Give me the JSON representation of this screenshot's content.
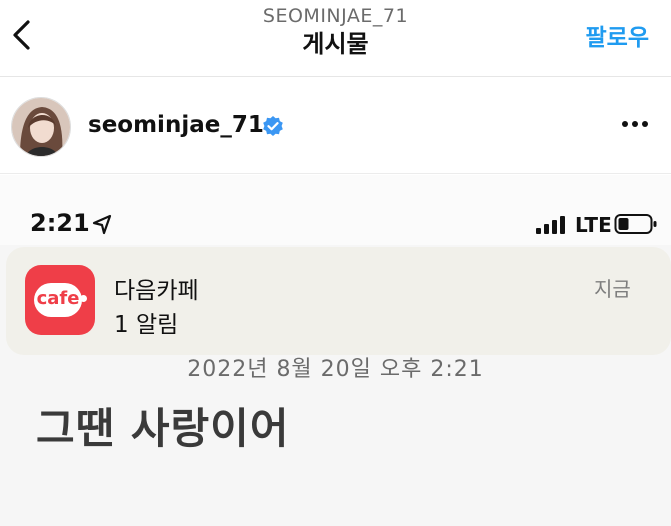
{
  "header": {
    "username": "SEOMINJAE_71",
    "title": "게시물",
    "follow_label": "팔로우"
  },
  "profile": {
    "name": "seominjae_71"
  },
  "post": {
    "status_bar": {
      "time": "2:21",
      "network": "LTE"
    },
    "notification": {
      "app_name": "다음카페",
      "app_icon_text": "cafe",
      "message": "1 알림",
      "time": "지금"
    },
    "timestamp": "2022년 8월 20일 오후 2:21",
    "headline": "그땐 사랑이어"
  },
  "colors": {
    "accent": "#1f9bf0",
    "app_icon": "#ef3e48"
  }
}
